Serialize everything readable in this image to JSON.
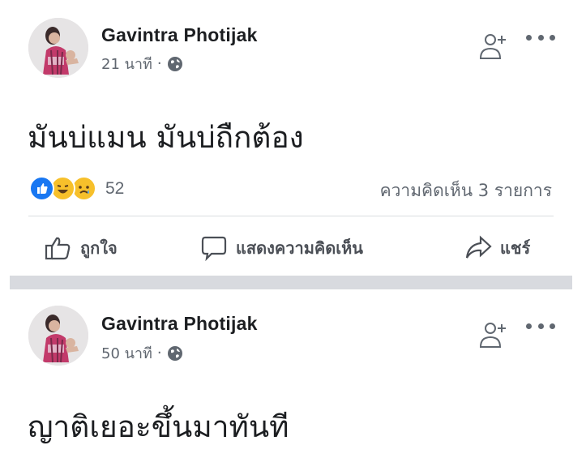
{
  "posts": [
    {
      "author": "Gavintra Photijak",
      "time": "21 นาที",
      "separator_dot": "·",
      "text": "มันบ่แมน มันบ่ถืกต้อง",
      "reaction_count": "52",
      "comments": "ความคิดเห็น 3 รายการ",
      "reaction_icons": [
        "like-icon",
        "haha-icon",
        "sad-icon"
      ],
      "actions": {
        "like": "ถูกใจ",
        "comment": "แสดงความคิดเห็น",
        "share": "แชร์"
      }
    },
    {
      "author": "Gavintra Photijak",
      "time": "50 นาที",
      "separator_dot": "·",
      "text": "ญาติเยอะขึ้นมาทันที"
    }
  ],
  "colors": {
    "like_blue": "#1877f2",
    "haha_yellow": "#f7c02b",
    "muted_text": "#606770",
    "feed_separator": "#d8dadf"
  }
}
